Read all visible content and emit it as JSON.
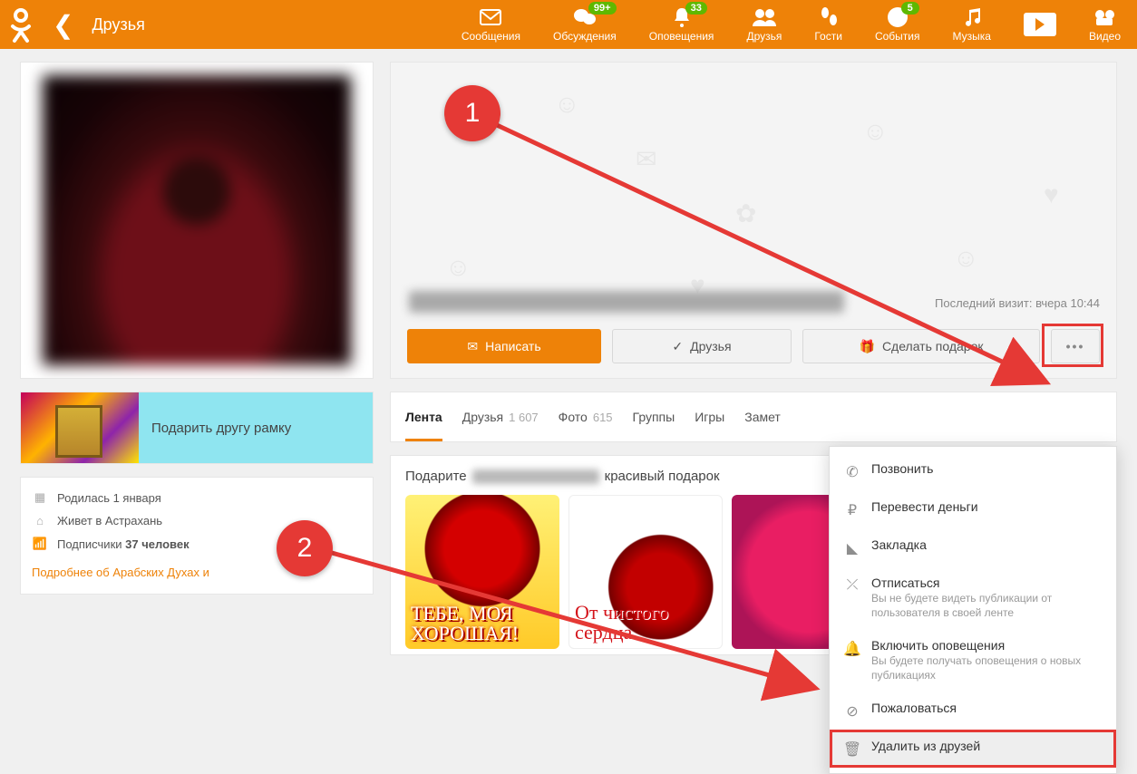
{
  "header": {
    "page_label": "Друзья",
    "nav": [
      {
        "key": "messages",
        "label": "Сообщения",
        "icon": "envelope"
      },
      {
        "key": "discussions",
        "label": "Обсуждения",
        "icon": "chat",
        "badge": "99+"
      },
      {
        "key": "notifications",
        "label": "Оповещения",
        "icon": "bell",
        "badge": "33"
      },
      {
        "key": "friends",
        "label": "Друзья",
        "icon": "people"
      },
      {
        "key": "guests",
        "label": "Гости",
        "icon": "footsteps"
      },
      {
        "key": "events",
        "label": "События",
        "icon": "star-badge",
        "badge": "5"
      },
      {
        "key": "music",
        "label": "Музыка",
        "icon": "music"
      },
      {
        "key": "play",
        "label": "",
        "icon": "play"
      },
      {
        "key": "video",
        "label": "Видео",
        "icon": "video"
      }
    ]
  },
  "profile": {
    "last_visit": "Последний визит: вчера 10:44",
    "actions": {
      "write": "Написать",
      "friends": "Друзья",
      "gift": "Сделать подарок"
    }
  },
  "gift_banner": "Подарить другу рамку",
  "info": {
    "born": "Родилась 1 января",
    "lives": "Живет в Астрахань",
    "subs_label": "Подписчики",
    "subs_count": "37 человек",
    "more_link": "Подробнее об Арабских Духах и"
  },
  "tabs": [
    {
      "label": "Лента",
      "active": true
    },
    {
      "label": "Друзья",
      "count": "1 607"
    },
    {
      "label": "Фото",
      "count": "615"
    },
    {
      "label": "Группы"
    },
    {
      "label": "Игры"
    },
    {
      "label": "Замет"
    }
  ],
  "gift_block": {
    "prefix": "Подарите",
    "suffix": "красивый подарок",
    "items": [
      {
        "caption": "ТЕБЕ, МОЯ ХОРОШАЯ!"
      },
      {
        "caption": "От чистого сердца"
      },
      {
        "caption": ""
      }
    ]
  },
  "dropdown": [
    {
      "icon": "phone",
      "title": "Позвонить"
    },
    {
      "icon": "ruble",
      "title": "Перевести деньги"
    },
    {
      "icon": "bookmark",
      "title": "Закладка"
    },
    {
      "icon": "unsub",
      "title": "Отписаться",
      "sub": "Вы не будете видеть публикации от пользователя в своей ленте"
    },
    {
      "icon": "bell",
      "title": "Включить оповещения",
      "sub": "Вы будете получать оповещения о новых публикациях"
    },
    {
      "icon": "report",
      "title": "Пожаловаться"
    },
    {
      "icon": "trash",
      "title": "Удалить из друзей",
      "hl": true
    }
  ],
  "annotations": {
    "a1": "1",
    "a2": "2"
  }
}
